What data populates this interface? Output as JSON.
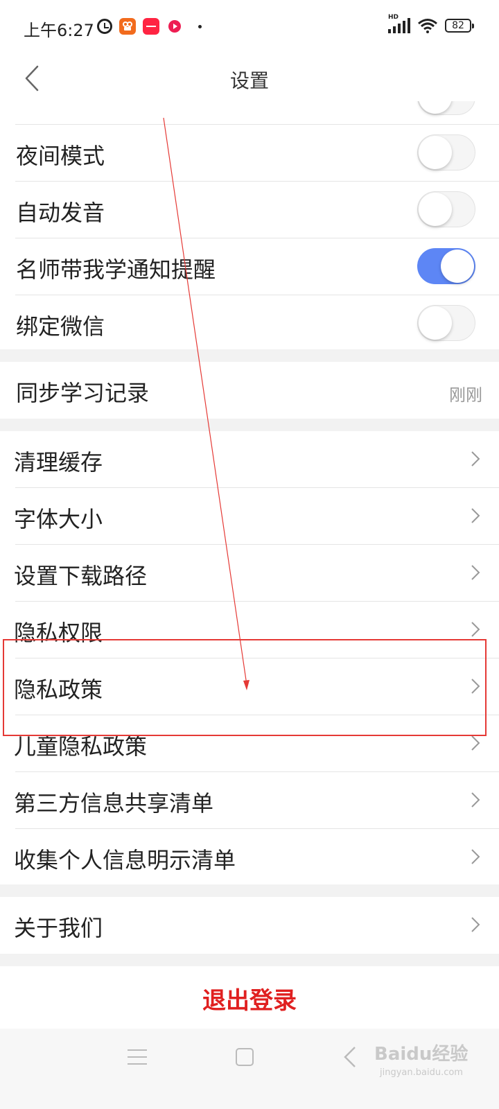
{
  "status_bar": {
    "time": "上午6:27",
    "hd_label": "HD",
    "battery": "82",
    "app_icons": [
      "kuaishou-icon",
      "xiaohongshu-icon",
      "video-app-icon"
    ]
  },
  "header": {
    "title": "设置"
  },
  "toggles": [
    {
      "label": "夜间模式",
      "on": false
    },
    {
      "label": "自动发音",
      "on": false
    },
    {
      "label": "名师带我学通知提醒",
      "on": true
    },
    {
      "label": "绑定微信",
      "on": false
    }
  ],
  "sync": {
    "label": "同步学习记录",
    "value": "刚刚"
  },
  "menu": [
    {
      "label": "清理缓存"
    },
    {
      "label": "字体大小"
    },
    {
      "label": "设置下载路径"
    },
    {
      "label": "隐私权限"
    },
    {
      "label": "隐私政策"
    },
    {
      "label": "儿童隐私政策"
    },
    {
      "label": "第三方信息共享清单"
    },
    {
      "label": "收集个人信息明示清单"
    }
  ],
  "about": {
    "label": "关于我们"
  },
  "logout": {
    "label": "退出登录"
  },
  "watermark": {
    "main": "Baidu经验",
    "sub": "jingyan.baidu.com"
  },
  "colors": {
    "accent_toggle": "#5d86f5",
    "logout_red": "#e02020",
    "annotation_red": "#e53935"
  }
}
